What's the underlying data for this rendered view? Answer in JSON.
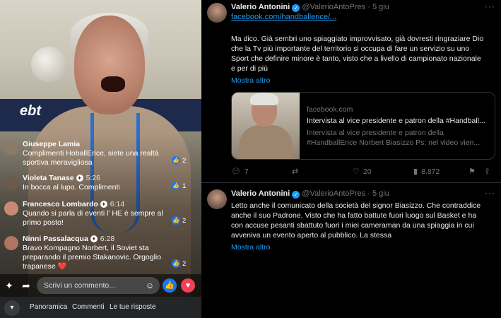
{
  "facebook": {
    "comments": [
      {
        "name": "Giuseppe Lamia",
        "time": "",
        "badge": "",
        "text": "Complimenti HoballErice, siete una realtà sportiva meravigliosa",
        "likes": "2",
        "avatar_color": "#8a7a66"
      },
      {
        "name": "Violeta Tanase",
        "time": "5:26",
        "badge": "♦",
        "text": "In bocca al lupo. Complimenti",
        "likes": "1",
        "avatar_color": "#6b5a4d"
      },
      {
        "name": "Francesco Lombardo",
        "time": "6:14",
        "badge": "♦",
        "text": "Quando si parla di eventi l' HE è sempre al primo posto!",
        "likes": "2",
        "avatar_color": "#c98a74"
      },
      {
        "name": "Ninni Passalacqua",
        "time": "6:28",
        "badge": "♦",
        "text": "Bravo Kompagno Norbert, il Soviet sta preparando il premio Stakanovic. Orgoglio trapanese ❤️",
        "likes": "2",
        "avatar_color": "#b07462"
      }
    ],
    "compose": {
      "placeholder": "Scrivi un commento...",
      "sticker_icon": "sticker-icon",
      "share_icon": "share-icon",
      "like_icon": "thumbs-up-icon",
      "love_icon": "heart-icon"
    },
    "tabs": [
      "Panoramica",
      "Commenti",
      "Le tue risposte"
    ],
    "collapse_icon": "chevron-down-icon",
    "banner_text": "ebt"
  },
  "twitter": {
    "tweets": [
      {
        "name": "Valerio Antonini",
        "handle": "@ValerioAntoPres",
        "time": "5 giu",
        "link": "facebook.com/handballerice/...",
        "text": "Ma dico. Già sembri uno spiaggiato improvvisato, già dovresti ringraziare Dio che la Tv più importante del territorio si occupa di fare un servizio su uno Sport che definire minore è tanto, visto che a livello di campionato nazionale e per di più",
        "show_more": "Mostra altro",
        "card": {
          "domain": "facebook.com",
          "title": "Intervista al vice presidente e patron della #Handball...",
          "description": "Intervista al vice presidente e patron della #HandballErice Norbert Biasizzo Ps: nel video vien..."
        },
        "actions": {
          "replies": "7",
          "retweets": "",
          "likes": "20",
          "views": "8.872"
        }
      },
      {
        "name": "Valerio Antonini",
        "handle": "@ValerioAntoPres",
        "time": "5 giu",
        "text": "Letto anche il comunicato della società del signor Biasizzo. Che contraddice anche il suo Padrone. Visto che ha fatto battute fuori luogo sul Basket e ha con accuse pesanti sbattuto fuori i miei cameraman da una spiaggia in cui avveniva un evento aperto al pubblico. La stessa",
        "show_more": "Mostra altro"
      }
    ],
    "verified_color": "#1d9bf0"
  }
}
